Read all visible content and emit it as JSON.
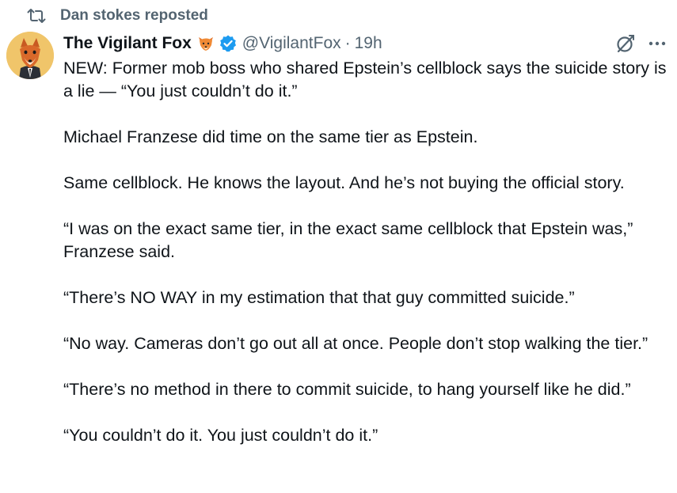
{
  "repost": {
    "label": "Dan stokes reposted"
  },
  "author": {
    "name": "The Vigilant Fox",
    "name_emoji": "fox-face-emoji",
    "handle": "@VigilantFox",
    "separator": "·",
    "time": "19h",
    "verified_color": "#1d9bf0"
  },
  "actions": {
    "grok": "grok-icon",
    "more": "more-icon"
  },
  "tweet": {
    "paragraphs": [
      "NEW: Former mob boss who shared Epstein’s cellblock says the suicide story is a lie — “You just couldn’t do it.”",
      "Michael Franzese did time on the same tier as Epstein.",
      "Same cellblock. He knows the layout. And he’s not buying the official story.",
      "“I was on the exact same tier, in the exact same cellblock that Epstein was,” Franzese said.",
      "“There’s NO WAY in my estimation that that guy committed suicide.”",
      "“No way. Cameras don’t go out all at once. People don’t stop walking the tier.”",
      "“There’s no method in there to commit suicide, to hang yourself like he did.”",
      "“You couldn’t do it. You just couldn’t do it.”"
    ]
  },
  "colors": {
    "text": "#0f1419",
    "secondary": "#536471",
    "accent": "#1d9bf0"
  }
}
